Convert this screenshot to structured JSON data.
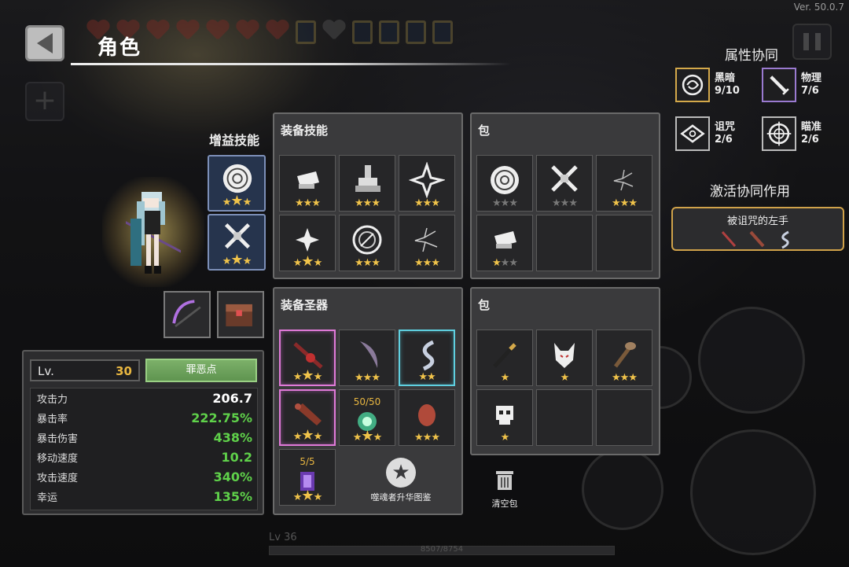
{
  "version": "Ver. 50.0.7",
  "header": {
    "title": "角色"
  },
  "buff_skills": {
    "label": "增益技能"
  },
  "stats": {
    "level_label": "Lv.",
    "level_value": "30",
    "sin_button": "罪恶点",
    "rows": [
      {
        "label": "攻击力",
        "value": "206.7",
        "color": "#ffffff"
      },
      {
        "label": "暴击率",
        "value": "222.75%",
        "color": "#5fd14a"
      },
      {
        "label": "暴击伤害",
        "value": "438%",
        "color": "#5fd14a"
      },
      {
        "label": "移动速度",
        "value": "10.2",
        "color": "#5fd14a"
      },
      {
        "label": "攻击速度",
        "value": "340%",
        "color": "#5fd14a"
      },
      {
        "label": "幸运",
        "value": "135%",
        "color": "#5fd14a"
      }
    ]
  },
  "skills_panel": {
    "title": "装备技能"
  },
  "skills_bag": {
    "title": "包"
  },
  "relics_panel": {
    "title": "装备圣器",
    "counter_1": "50/50",
    "counter_2": "5/5",
    "codex_label": "噬魂者升华图鉴"
  },
  "relics_bag": {
    "title": "包"
  },
  "trash": {
    "label": "清空包"
  },
  "synergy": {
    "title": "属性协同",
    "items": [
      {
        "name": "黑暗",
        "count": "9/10",
        "icon": "dark-swirl-icon"
      },
      {
        "name": "物理",
        "count": "7/6",
        "icon": "sword-icon"
      },
      {
        "name": "诅咒",
        "count": "2/6",
        "icon": "curse-eye-icon"
      },
      {
        "name": "瞄准",
        "count": "2/6",
        "icon": "crosshair-icon"
      }
    ],
    "active_title": "激活协同作用",
    "active_name": "被诅咒的左手"
  },
  "footer": {
    "level": "Lv 36",
    "exp": "8507/8754"
  },
  "colors": {
    "star": "#f0c34a",
    "green_stat": "#5fd14a",
    "gold_border": "#d0a24a"
  }
}
